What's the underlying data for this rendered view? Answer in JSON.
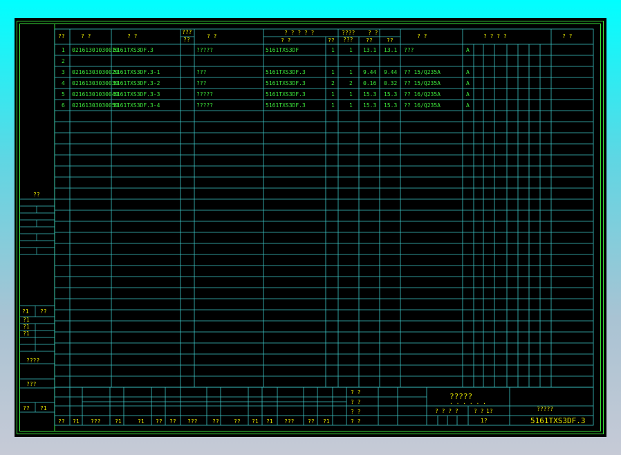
{
  "header": {
    "col_no": "??",
    "col_code": "? ?",
    "col_drawing": "?          ?",
    "col_count": "???\n??",
    "col_name": "?          ?",
    "col_ref_group": "? ? ? ? ?",
    "col_ref": "?     ?",
    "col_ref_qty": "??",
    "col_qty_group": "????\n???",
    "col_weight_group": "?      ?",
    "col_weight_unit": "??",
    "col_weight_total": "??",
    "col_material": "?        ?",
    "col_remark_group": "?    ?    ?    ?",
    "col_note": "?    ?"
  },
  "rows": [
    {
      "no": "1",
      "code": "02161301030010",
      "drawing": "5161TXS3DF.3",
      "name": "?????",
      "ref": "5161TXS3DF",
      "q1": "1",
      "q2": "1",
      "w1": "13.1",
      "w2": "13.1",
      "material": "???",
      "grade": "A"
    },
    {
      "no": "2",
      "code": "",
      "drawing": "",
      "name": "",
      "ref": "",
      "q1": "",
      "q2": "",
      "w1": "",
      "w2": "",
      "material": "",
      "grade": ""
    },
    {
      "no": "3",
      "code": "02161303030020",
      "drawing": "5161TXS3DF.3-1",
      "name": "???",
      "ref": "5161TXS3DF.3",
      "q1": "1",
      "q2": "1",
      "w1": "9.44",
      "w2": "9.44",
      "material": "?? 15/Q235A",
      "grade": "A"
    },
    {
      "no": "4",
      "code": "02161303030030",
      "drawing": "5161TXS3DF.3-2",
      "name": "???",
      "ref": "5161TXS3DF.3",
      "q1": "2",
      "q2": "2",
      "w1": "0.16",
      "w2": "0.32",
      "material": "?? 15/Q235A",
      "grade": "A"
    },
    {
      "no": "5",
      "code": "02161301030040",
      "drawing": "5161TXS3DF.3-3",
      "name": "?????",
      "ref": "5161TXS3DF.3",
      "q1": "1",
      "q2": "1",
      "w1": "15.3",
      "w2": "15.3",
      "material": "?? 16/Q235A",
      "grade": "A"
    },
    {
      "no": "6",
      "code": "02161303030050",
      "drawing": "5161TXS3DF.3-4",
      "name": "?????",
      "ref": "5161TXS3DF.3",
      "q1": "1",
      "q2": "1",
      "w1": "15.3",
      "w2": "15.3",
      "material": "?? 16/Q235A",
      "grade": "A"
    }
  ],
  "left_strip": {
    "label_top": "??",
    "label_a": "?1",
    "label_b": "??",
    "label_c": "?1",
    "label_d": "?1",
    "label_e": "?1",
    "label_f": "????",
    "label_g": "???",
    "label_h1": "??",
    "label_h2": "?1"
  },
  "title_block": {
    "stage1": "? ?",
    "stage2": "? ?",
    "stage3": "? ?",
    "stage4": "? ?",
    "doc_title": "?????",
    "doc_sub": ". . . . . .",
    "scale_label": "? ? ? ?",
    "sheet_label": "?  ?",
    "sheet_no": "1?",
    "sheet_total": "1?",
    "company": "?????",
    "drawing_no": "5161TXS3DF.3",
    "sig1": "??",
    "sig2": "?1",
    "sig3": "???",
    "sig4": "?1",
    "sig5": "?1",
    "sig6": "??",
    "sig7": "??",
    "sig8": "???",
    "sig9": "??",
    "sig10": "??",
    "sig11": "?1",
    "sig12": "?1",
    "sig13": "???",
    "sig14": "??",
    "sig15": "?1"
  }
}
